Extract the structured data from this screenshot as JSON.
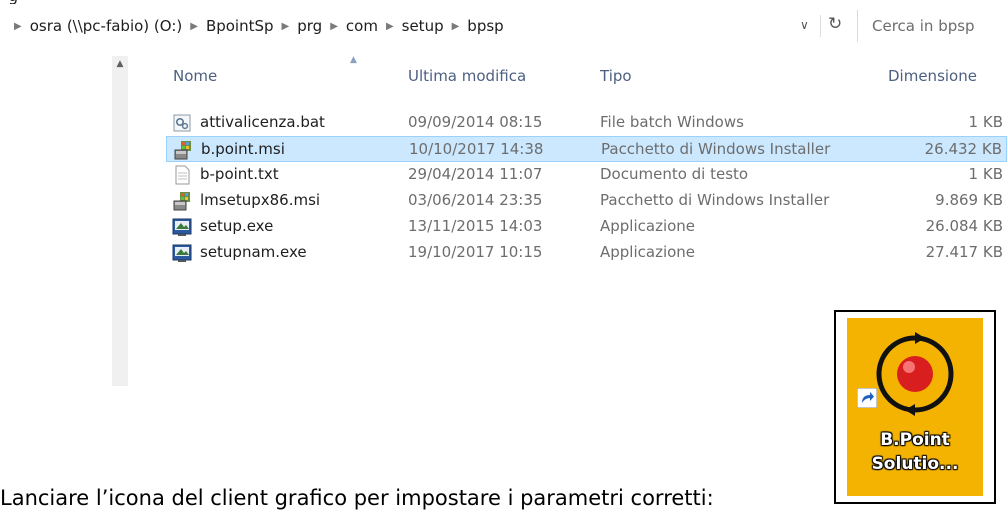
{
  "address": {
    "crumbs": [
      "osra (\\\\pc-fabio) (O:)",
      "BpointSp",
      "prg",
      "com",
      "setup",
      "bpsp"
    ],
    "search_placeholder": "Cerca in bpsp"
  },
  "columns": {
    "name": "Nome",
    "modified": "Ultima modifica",
    "type": "Tipo",
    "size": "Dimensione"
  },
  "files": [
    {
      "name": "attivalicenza.bat",
      "modified": "09/09/2014 08:15",
      "type": "File batch Windows",
      "size": "1 KB",
      "icon": "batch-file-icon",
      "selected": false
    },
    {
      "name": "b.point.msi",
      "modified": "10/10/2017 14:38",
      "type": "Pacchetto di Windows Installer",
      "size": "26.432 KB",
      "icon": "msi-installer-icon",
      "selected": true
    },
    {
      "name": "b-point.txt",
      "modified": "29/04/2014 11:07",
      "type": "Documento di testo",
      "size": "1 KB",
      "icon": "text-file-icon",
      "selected": false
    },
    {
      "name": "lmsetupx86.msi",
      "modified": "03/06/2014 23:35",
      "type": "Pacchetto di Windows Installer",
      "size": "9.869 KB",
      "icon": "msi-installer-icon",
      "selected": false
    },
    {
      "name": "setup.exe",
      "modified": "13/11/2015 14:03",
      "type": "Applicazione",
      "size": "26.084 KB",
      "icon": "setup-exe-icon",
      "selected": false
    },
    {
      "name": "setupnam.exe",
      "modified": "19/10/2017 10:15",
      "type": "Applicazione",
      "size": "27.417 KB",
      "icon": "setup-exe-icon",
      "selected": false
    }
  ],
  "caption": "Lanciare l’icona del client grafico per impostare i parametri corretti:",
  "desktop_icon": {
    "label_line1": "B.Point",
    "label_line2": "Solutio...",
    "tile_color": "#f5b301"
  },
  "colors": {
    "selection_bg": "#cce8ff",
    "selection_border": "#99d1ff",
    "header_text": "#4d6082"
  }
}
